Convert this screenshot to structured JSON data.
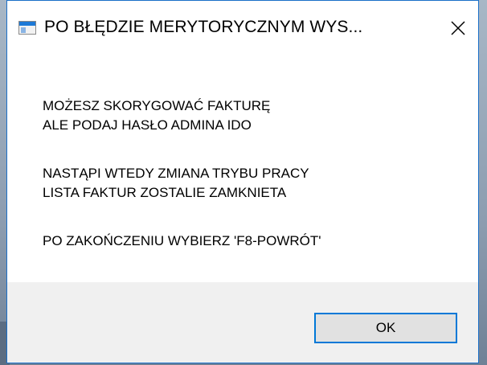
{
  "window": {
    "title": "PO BŁĘDZIE MERYTORYCZNYM WYS...",
    "icon": "app-window-icon",
    "close_icon": "close-icon"
  },
  "message": {
    "lines": [
      "MOŻESZ SKORYGOWAĆ FAKTURĘ",
      "ALE PODAJ HASŁO ADMINA IDO",
      "NASTĄPI WTEDY ZMIANA TRYBU PRACY",
      "LISTA FAKTUR ZOSTALIE  ZAMKNIETA",
      "PO ZAKOŃCZENIU WYBIERZ 'F8-POWRÓT'"
    ]
  },
  "buttons": {
    "ok_label": "OK"
  },
  "colors": {
    "accent": "#0078d7",
    "window_border": "#1a6fc8",
    "footer_bg": "#f0f0f0",
    "button_bg": "#e1e1e1"
  }
}
